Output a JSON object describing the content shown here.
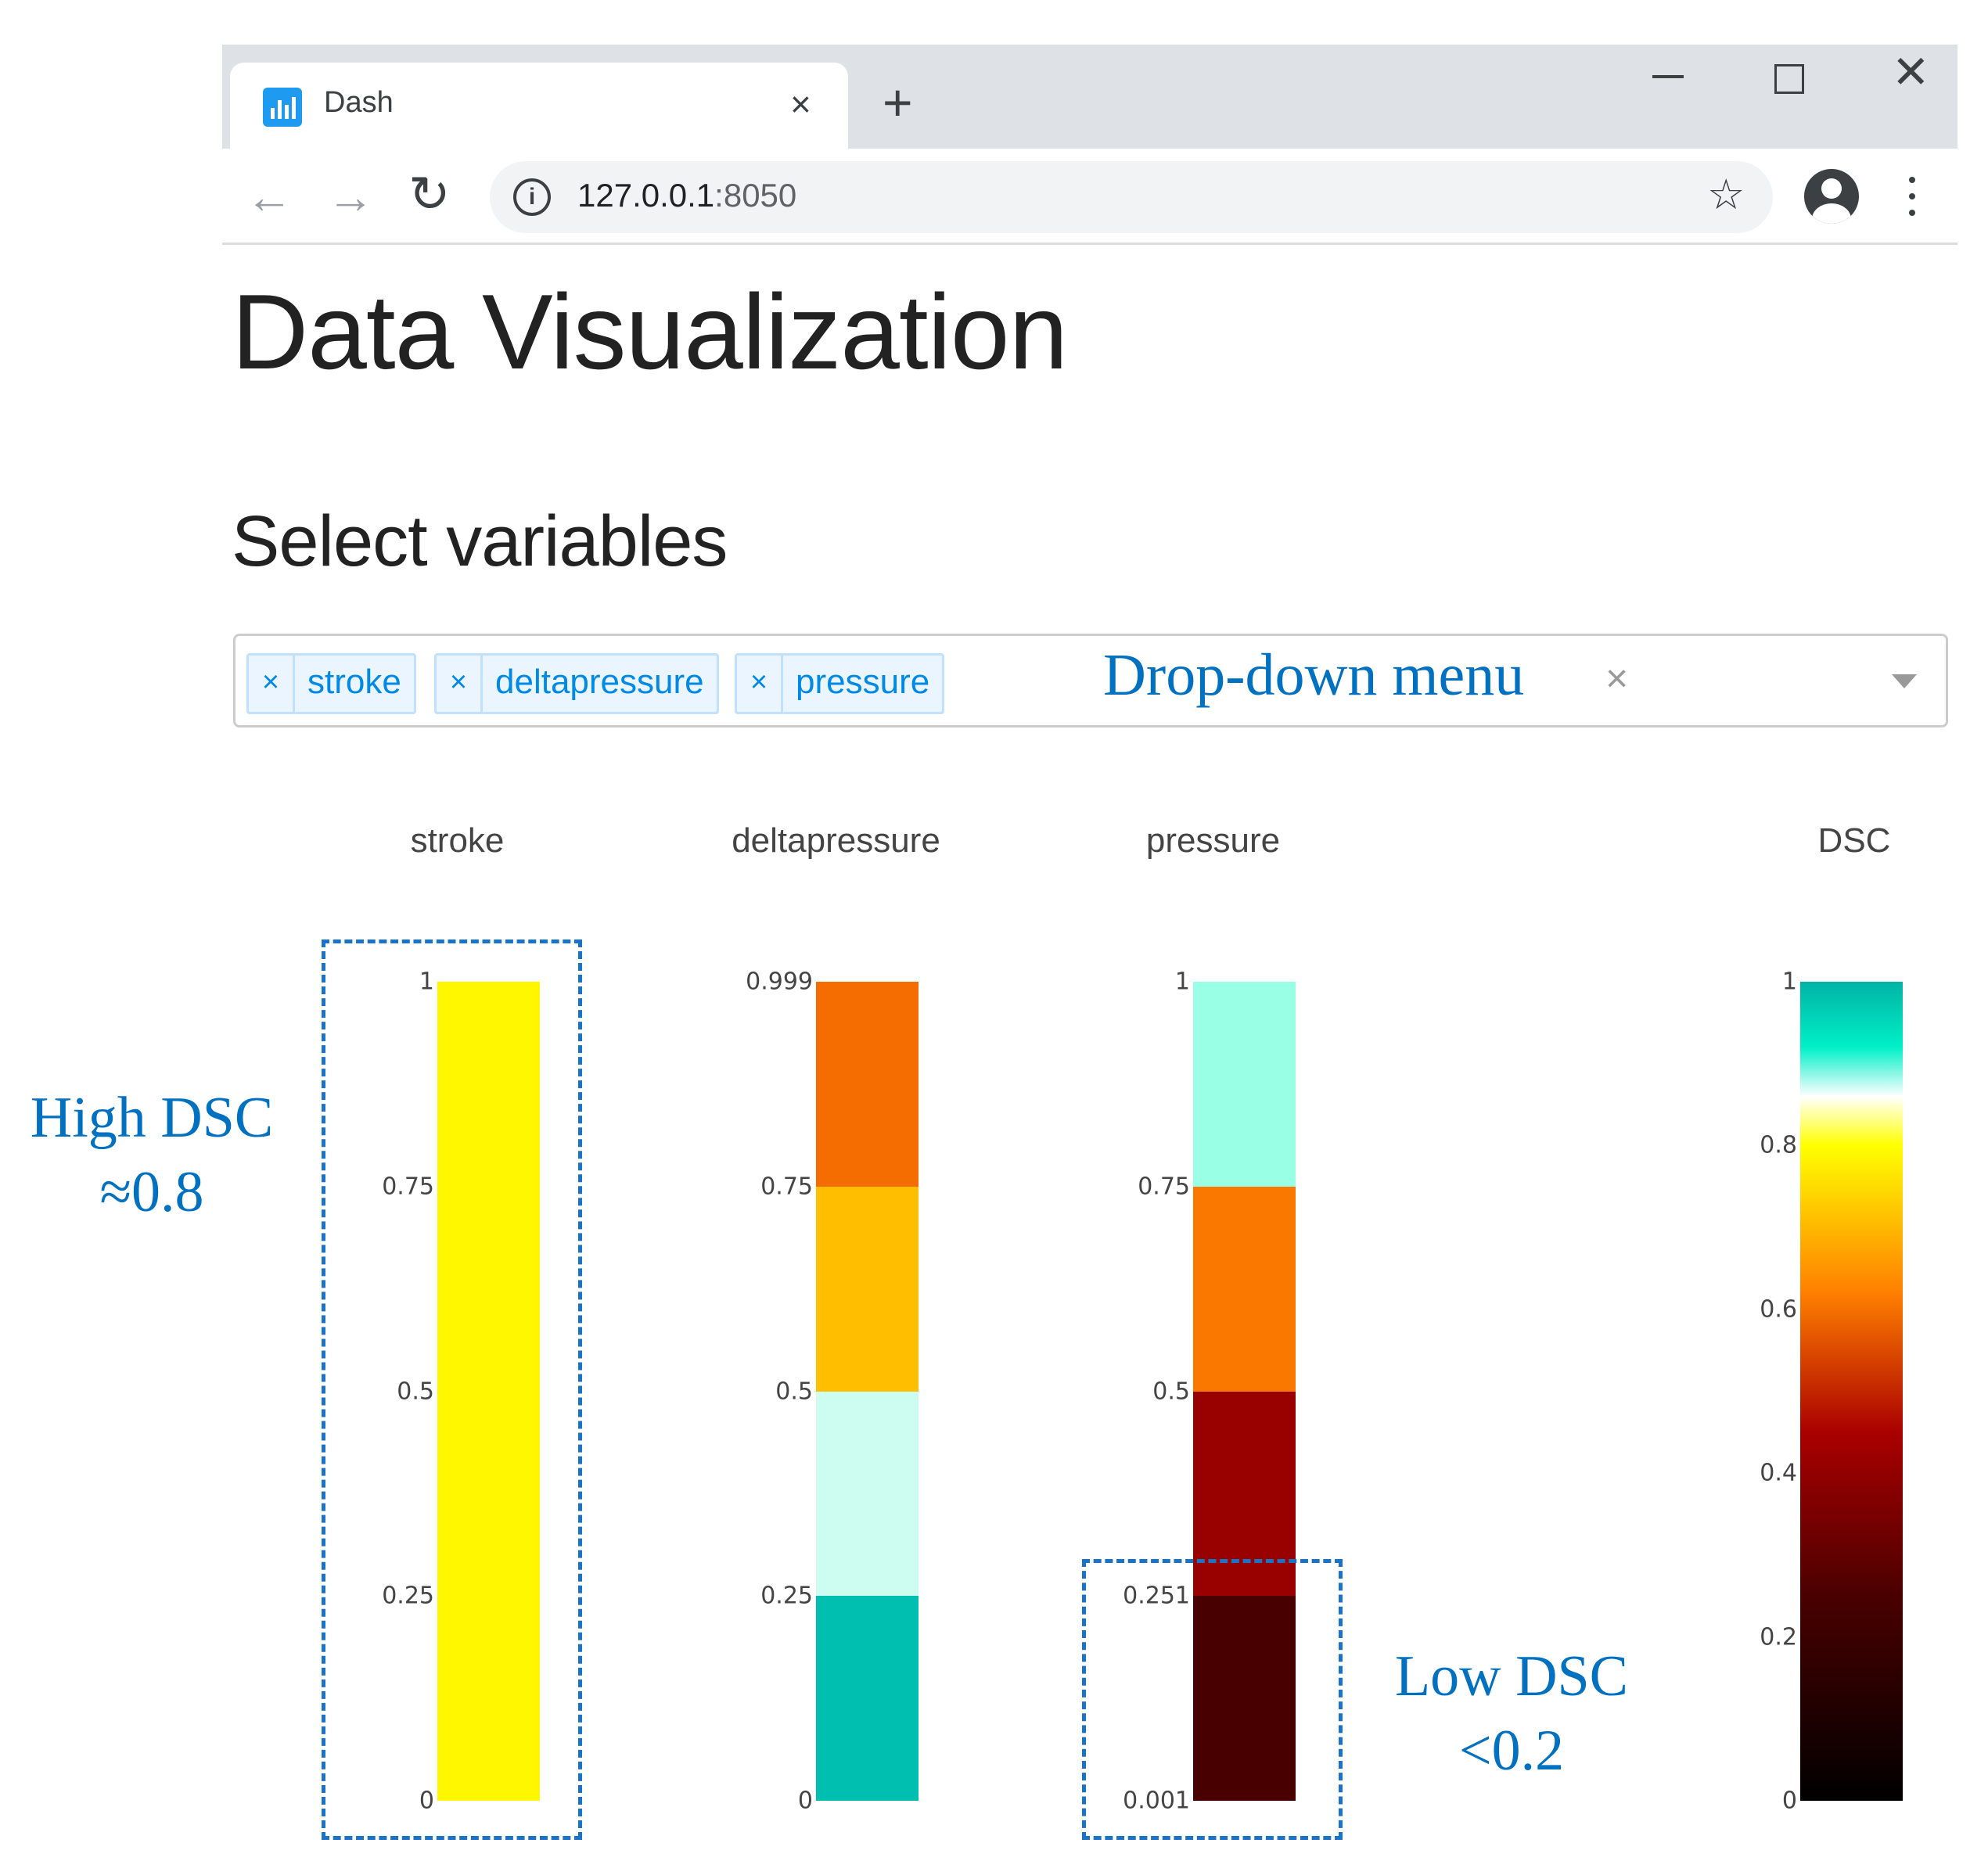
{
  "browser": {
    "tab_title": "Dash",
    "tab_close": "×",
    "new_tab": "+",
    "url_host": "127.0.0.1",
    "url_port": ":8050"
  },
  "page": {
    "title": "Data Visualization",
    "section_title": "Select variables"
  },
  "dropdown": {
    "selected": [
      "stroke",
      "deltapressure",
      "pressure"
    ],
    "chip_remove": "×",
    "clear": "×"
  },
  "annotations": {
    "dropdown": "Drop-down menu",
    "high_line1": "High DSC",
    "high_line2": "≈0.8",
    "low_line1": "Low DSC",
    "low_line2": "<0.2"
  },
  "chart_data": {
    "type": "heatmap",
    "colorscale_title": "DSC",
    "colorscale_ticks": [
      "0",
      "0.2",
      "0.4",
      "0.6",
      "0.8",
      "1"
    ],
    "colorscale_range": [
      0,
      1
    ],
    "colorscale_stops": [
      {
        "v": 0.0,
        "c": "#000000"
      },
      {
        "v": 0.25,
        "c": "#4a0000"
      },
      {
        "v": 0.45,
        "c": "#aa0000"
      },
      {
        "v": 0.62,
        "c": "#ff7f00"
      },
      {
        "v": 0.8,
        "c": "#ffff00"
      },
      {
        "v": 0.86,
        "c": "#ffffff"
      },
      {
        "v": 0.92,
        "c": "#00f0c8"
      },
      {
        "v": 1.0,
        "c": "#00b3a4"
      }
    ],
    "columns": [
      {
        "name": "stroke",
        "ticks": [
          {
            "v": 0,
            "t": "0"
          },
          {
            "v": 0.25,
            "t": "0.25"
          },
          {
            "v": 0.5,
            "t": "0.5"
          },
          {
            "v": 0.75,
            "t": "0.75"
          },
          {
            "v": 1,
            "t": "1"
          }
        ],
        "segments": [
          {
            "from": 0,
            "to": 1,
            "color": "#fff700"
          }
        ]
      },
      {
        "name": "deltapressure",
        "ticks": [
          {
            "v": 0,
            "t": "0"
          },
          {
            "v": 0.25,
            "t": "0.25"
          },
          {
            "v": 0.5,
            "t": "0.5"
          },
          {
            "v": 0.75,
            "t": "0.75"
          },
          {
            "v": 1,
            "t": "0.999"
          }
        ],
        "segments": [
          {
            "from": 0,
            "to": 0.25,
            "color": "#00bfb0"
          },
          {
            "from": 0.25,
            "to": 0.5,
            "color": "#ccfdf0"
          },
          {
            "from": 0.5,
            "to": 0.75,
            "color": "#ffbf00"
          },
          {
            "from": 0.75,
            "to": 1,
            "color": "#f56c00"
          }
        ]
      },
      {
        "name": "pressure",
        "ticks": [
          {
            "v": 0,
            "t": "0.001"
          },
          {
            "v": 0.25,
            "t": "0.251"
          },
          {
            "v": 0.5,
            "t": "0.5"
          },
          {
            "v": 0.75,
            "t": "0.75"
          },
          {
            "v": 1,
            "t": "1"
          }
        ],
        "segments": [
          {
            "from": 0,
            "to": 0.25,
            "color": "#480000"
          },
          {
            "from": 0.25,
            "to": 0.5,
            "color": "#990000"
          },
          {
            "from": 0.5,
            "to": 0.75,
            "color": "#fa7800"
          },
          {
            "from": 0.75,
            "to": 1,
            "color": "#99ffe5"
          }
        ]
      }
    ]
  }
}
